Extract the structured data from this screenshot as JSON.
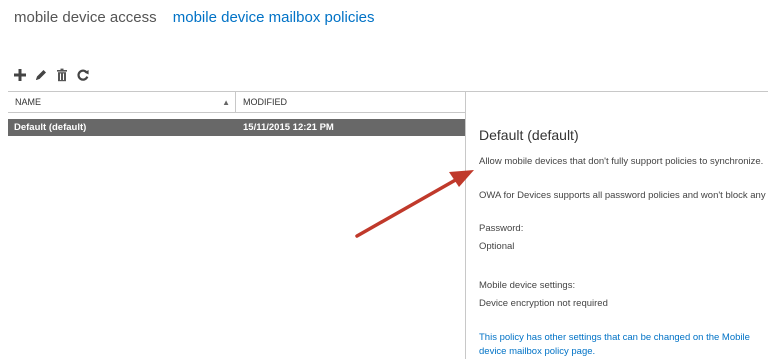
{
  "tabs": [
    {
      "label": "mobile device access",
      "active": false
    },
    {
      "label": "mobile device mailbox policies",
      "active": true
    }
  ],
  "toolbar": {
    "buttons": [
      {
        "icon": "plus-icon"
      },
      {
        "icon": "pencil-icon"
      },
      {
        "icon": "trash-icon"
      },
      {
        "icon": "refresh-icon"
      }
    ]
  },
  "grid": {
    "columns": [
      {
        "label": "NAME",
        "sort": "ascending"
      },
      {
        "label": "MODIFIED"
      }
    ],
    "rows": [
      {
        "name": "Default (default)",
        "modified": "15/11/2015 12:21 PM",
        "selected": true
      }
    ]
  },
  "details": {
    "title": "Default (default)",
    "allow_text": "Allow mobile devices that don't fully support policies to synchronize.",
    "owa_text": "OWA for Devices supports all password policies and won't block any d",
    "password_label": "Password:",
    "password_value": "Optional",
    "settings_label": "Mobile device settings:",
    "settings_value": "Device encryption not required",
    "link_text": "This policy has other settings that can be changed on the Mobile device mailbox policy page."
  },
  "colors": {
    "accent": "#0072c6",
    "selected_row": "#686868",
    "arrow": "#c0392b"
  }
}
